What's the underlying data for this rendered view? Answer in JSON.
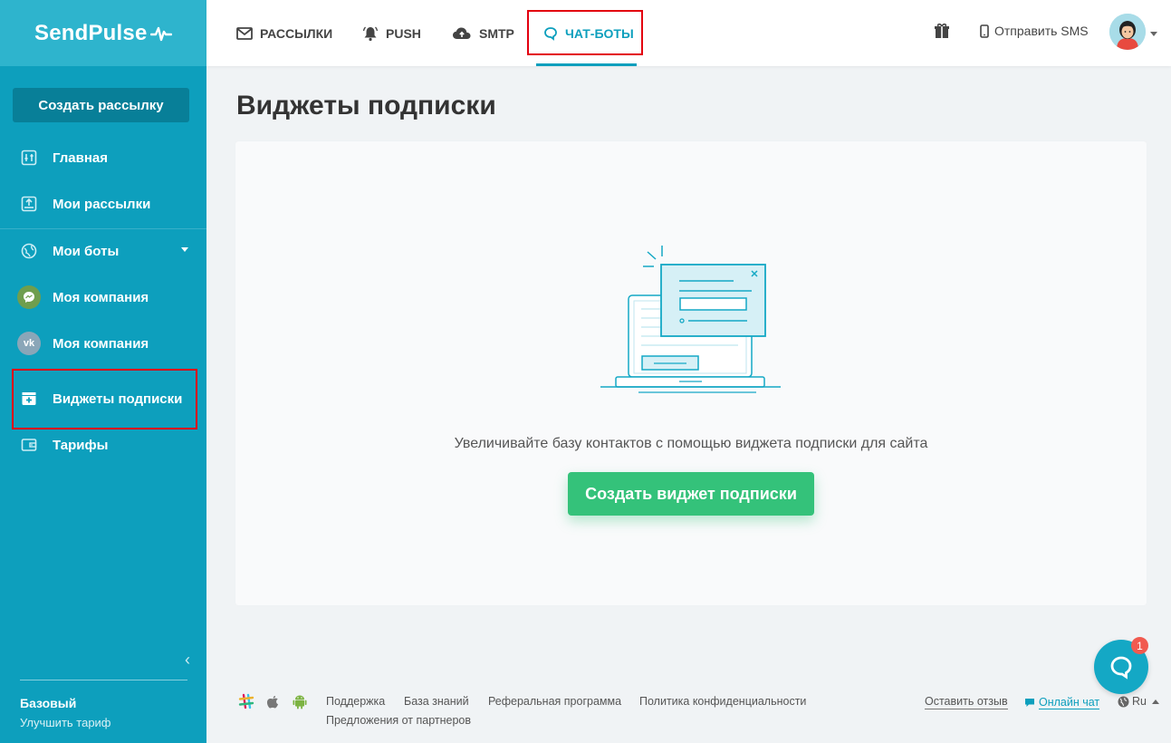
{
  "app": {
    "logo": "SendPulse"
  },
  "sidebar": {
    "create_button": "Создать рассылку",
    "items": [
      {
        "label": "Главная",
        "icon": "dashboard-icon"
      },
      {
        "label": "Мои рассылки",
        "icon": "campaigns-icon"
      },
      {
        "label": "Мои боты",
        "icon": "bots-icon"
      },
      {
        "label": "Моя компания",
        "icon": "messenger-icon"
      },
      {
        "label": "Моя компания",
        "icon": "vk-icon",
        "icon_text": "vk"
      },
      {
        "label": "Виджеты подписки",
        "icon": "widget-icon"
      },
      {
        "label": "Тарифы",
        "icon": "wallet-icon"
      }
    ],
    "plan": {
      "name": "Базовый",
      "upgrade": "Улучшить тариф"
    }
  },
  "header": {
    "tabs": [
      {
        "label": "РАССЫЛКИ",
        "icon": "mail-icon"
      },
      {
        "label": "PUSH",
        "icon": "bell-icon"
      },
      {
        "label": "SMTP",
        "icon": "cloud-upload-icon"
      },
      {
        "label": "ЧАТ-БОТЫ",
        "icon": "chat-icon",
        "active": true
      }
    ],
    "sms_label": "Отправить SMS"
  },
  "main": {
    "title": "Виджеты подписки",
    "empty_text": "Увеличивайте базу контактов с помощью виджета подписки для сайта",
    "cta": "Создать виджет подписки"
  },
  "footer": {
    "links": [
      "Поддержка",
      "База знаний",
      "Реферальная программа",
      "Политика конфиденциальности",
      "Предложения от партнеров"
    ],
    "feedback": "Оставить отзыв",
    "online_chat": "Онлайн чат",
    "lang": "Ru"
  },
  "chat_widget": {
    "badge": "1"
  },
  "colors": {
    "sidebar": "#0d9fbd",
    "logo_bg": "#2eb4cd",
    "accent": "#0d9fbd",
    "cta": "#34c27a",
    "highlight": "#e3000f"
  }
}
